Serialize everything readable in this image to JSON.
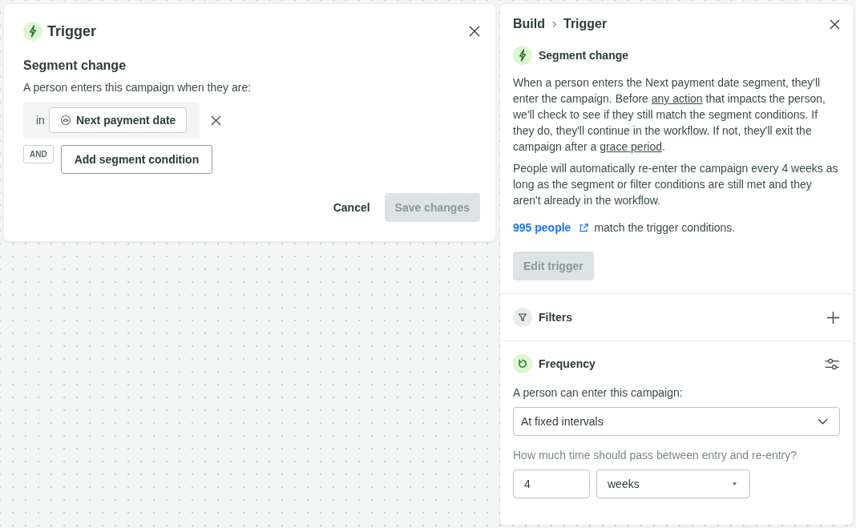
{
  "modal": {
    "title": "Trigger",
    "section_title": "Segment change",
    "prompt": "A person enters this campaign when they are:",
    "conditions": [
      {
        "operator": "in",
        "segment": "Next payment date"
      }
    ],
    "join": "AND",
    "add_button": "Add segment condition",
    "cancel": "Cancel",
    "save": {
      "label": "Save changes",
      "disabled": true
    }
  },
  "panel": {
    "breadcrumb": [
      "Build",
      "Trigger"
    ],
    "trigger_title": "Segment change",
    "description": [
      {
        "kind": "text",
        "text": "When a person enters the Next payment date segment, they'll enter the campaign. Before "
      },
      {
        "kind": "link",
        "text": "any action"
      },
      {
        "kind": "text",
        "text": " that impacts the person, we'll check to see if they still match the segment conditions. If they do, they'll continue in the workflow. If not, they'll exit the campaign after a "
      },
      {
        "kind": "link",
        "text": "grace period"
      },
      {
        "kind": "text",
        "text": "."
      }
    ],
    "note": "People will automatically re-enter the campaign every 4 weeks as long as the segment or filter conditions are still met and they aren't already in the workflow.",
    "count_link": "995 people",
    "count_suffix": "match the trigger conditions.",
    "edit_button": {
      "label": "Edit trigger",
      "disabled": true
    },
    "filters": {
      "title": "Filters"
    },
    "frequency": {
      "title": "Frequency",
      "prompt": "A person can enter this campaign:",
      "mode": "At fixed intervals",
      "interval_question": "How much time should pass between entry and re-entry?",
      "interval_value": "4",
      "interval_unit": "weeks"
    }
  }
}
